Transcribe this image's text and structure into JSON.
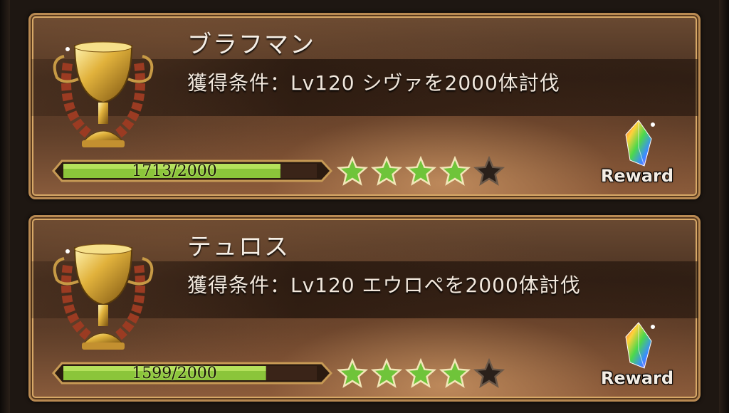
{
  "achievements": [
    {
      "name": "ブラフマン",
      "condition": "獲得条件：Lv120 シヴァを2000体討伐",
      "progress_text": "1713/2000",
      "progress_current": 1713,
      "progress_total": 2000,
      "stars_filled": 4,
      "stars_total": 5,
      "reward_label": "Reward"
    },
    {
      "name": "テュロス",
      "condition": "獲得条件：Lv120 エウロペを2000体討伐",
      "progress_text": "1599/2000",
      "progress_current": 1599,
      "progress_total": 2000,
      "stars_filled": 4,
      "stars_total": 5,
      "reward_label": "Reward"
    }
  ],
  "icons": {
    "trophy": "gold-trophy-icon",
    "star_filled": "green-star-icon",
    "star_empty": "dark-star-icon",
    "reward": "rainbow-crystal-icon"
  },
  "colors": {
    "bar_fill": "#8bc53a",
    "bar_track": "#3a2418",
    "star_green": "#6fc43a",
    "star_dark": "#2a201a",
    "frame_gold": "#d7a867"
  }
}
